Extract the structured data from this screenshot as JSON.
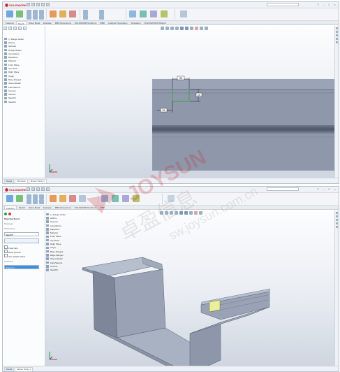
{
  "top": {
    "app_brand": "SOLIDWORKS",
    "tabs": [
      "Features",
      "Sketch",
      "Sheet Metal",
      "Evaluate",
      "MBD Dimensions",
      "SOLIDWORKS Add-Ins",
      "MBD",
      "Analysis Preparation",
      "Simulation",
      "SOLIDWORKS Plastics"
    ],
    "active_tab": 1,
    "sketch_dims": {
      "width": "30",
      "height": "10",
      "offset": "25"
    },
    "status_tabs": [
      "Model",
      "3D Views",
      "Motion Study 1"
    ],
    "tree_items": [
      "(-) Flange Gutter",
      "History",
      "Sensors",
      "Design Binder",
      "Annotations",
      "Equations",
      "Material",
      "Front Plane",
      "Top Plane",
      "Right Plane",
      "Origin",
      "Base-Flange1",
      "Sheet-Metal1",
      "Flat-Pattern1",
      "Cut-List",
      "Sketch1",
      "Sketch2",
      "Sketch3"
    ]
  },
  "bottom": {
    "app_brand": "SOLIDWORKS",
    "tabs": [
      "Features",
      "Sketch",
      "Sheet Metal",
      "Evaluate",
      "MBD Dimensions",
      "SOLIDWORKS Add-Ins",
      "MBD"
    ],
    "pm_title": "Sketched Bend",
    "pm_sections": [
      "Message",
      "Parameters",
      "Favorites"
    ],
    "pm_field_value": "Sketch5",
    "pm_options": [
      "Fixed face",
      "Bend position",
      "Use default radius"
    ],
    "pm_face_item": "Face<1>",
    "tree_items": [
      "(-) Flange Gutter",
      "History",
      "Sensors",
      "Annotations",
      "Equations",
      "Material",
      "Front Plane",
      "Top Plane",
      "Right Plane",
      "Origin",
      "Base-Flange1",
      "Edge-Flange1",
      "Sheet-Metal1",
      "Flat-Pattern1",
      "Cut-List",
      "Sketch5"
    ],
    "status_tabs": [
      "Model",
      "Motion Study 1"
    ]
  },
  "watermark": {
    "text_cn": "卓盈信息",
    "brand": "JOYSUN",
    "url": "sw.joysun.com.cn"
  },
  "colors": {
    "brand_red": "#c8202a",
    "part_face": "#9ea8ba",
    "sketch_green": "#2fa83a",
    "select_blue": "#3d8fe0",
    "highlight_yellow": "#e9ef9a"
  }
}
